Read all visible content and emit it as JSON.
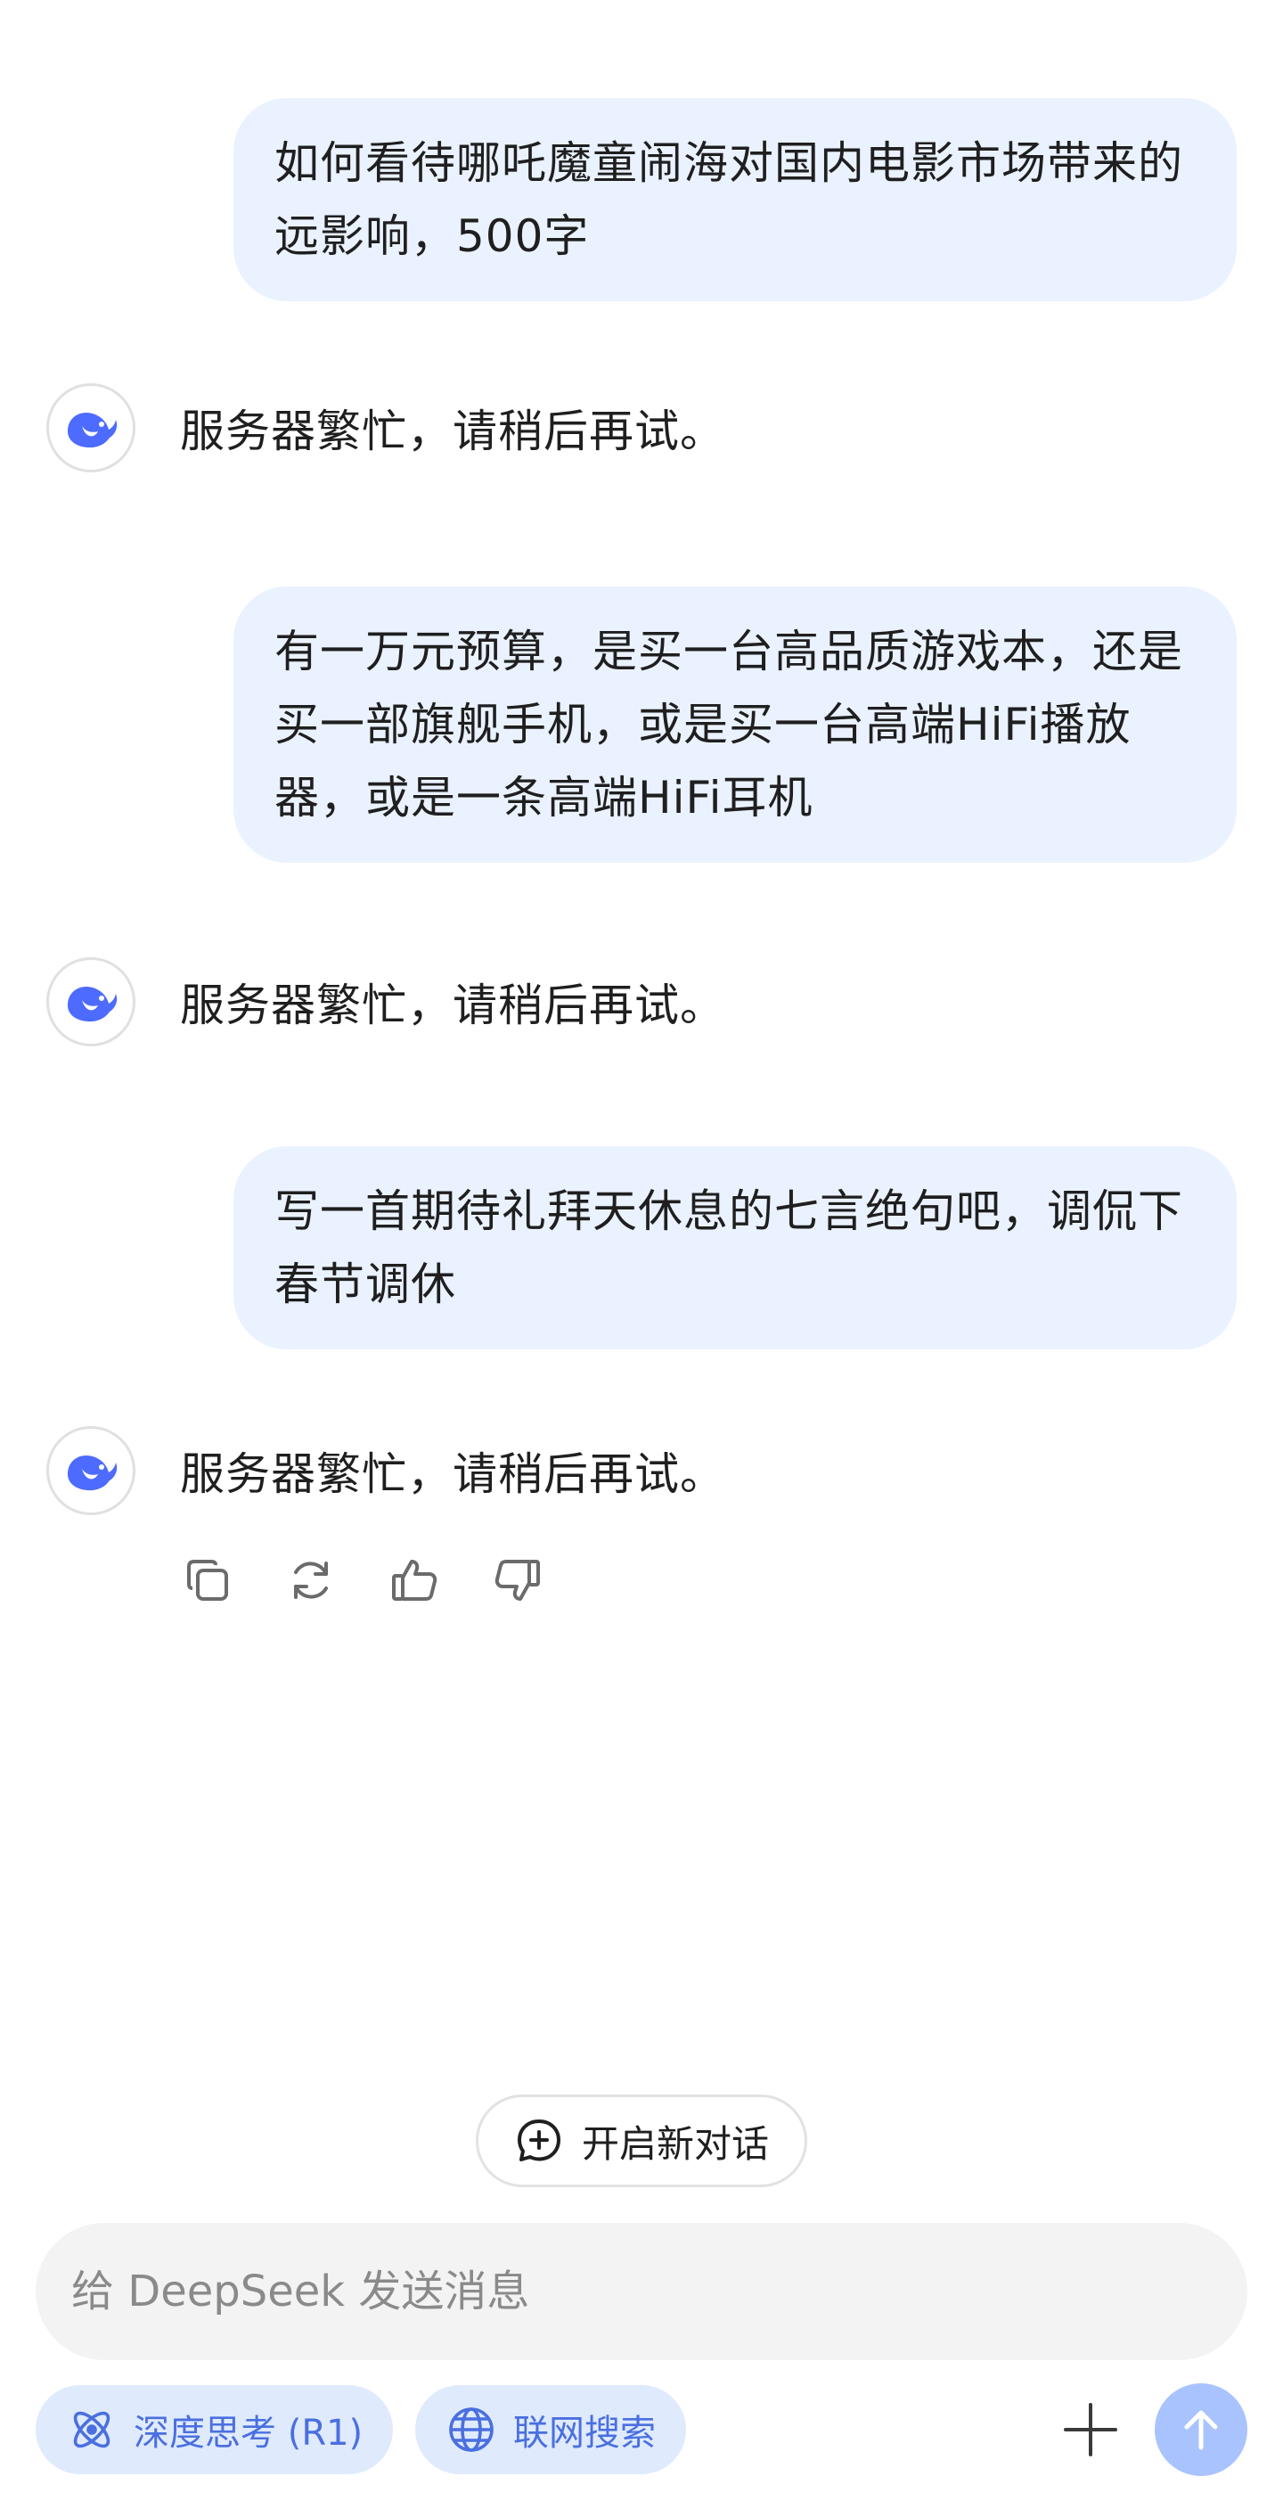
{
  "colors": {
    "user_bubble": "#eaf2ff",
    "accent": "#4d6bfe",
    "pill_bg": "#dfeafd",
    "send_button": "#a9c3ff"
  },
  "messages": [
    {
      "role": "user",
      "text": "如何看待哪吒魔童闹海对国内电影市场带来的远影响，500字"
    },
    {
      "role": "assistant",
      "text": "服务器繁忙，请稍后再试。"
    },
    {
      "role": "user",
      "text": "有一万元预算，是买一台高品质游戏本，还是买一部旗舰手机，或是买一台高端HiFi播放器，或是一条高端HiFi耳机"
    },
    {
      "role": "assistant",
      "text": "服务器繁忙，请稍后再试。"
    },
    {
      "role": "user",
      "text": "写一首期待礼拜天休息的七言绝句吧，调侃下春节调休"
    },
    {
      "role": "assistant",
      "text": "服务器繁忙，请稍后再试。"
    }
  ],
  "message_actions": [
    "copy-icon",
    "regenerate-icon",
    "thumbs-up-icon",
    "thumbs-down-icon"
  ],
  "new_chat": {
    "label": "开启新对话",
    "icon": "chat-plus-icon"
  },
  "composer": {
    "placeholder": "给 DeepSeek 发送消息"
  },
  "toggles": {
    "deep_think": {
      "label": "深度思考 (R1)",
      "icon": "atom-icon"
    },
    "web_search": {
      "label": "联网搜索",
      "icon": "globe-icon"
    }
  },
  "buttons": {
    "attach_icon": "plus-icon",
    "send_icon": "arrow-up-icon"
  }
}
